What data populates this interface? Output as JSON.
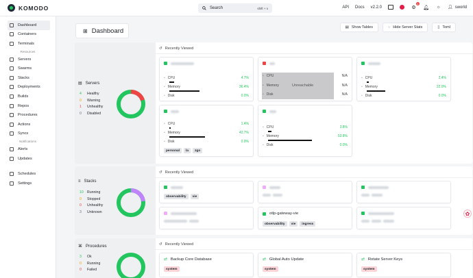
{
  "app": {
    "name": "KOMODO",
    "version": "v2.2.0",
    "user": "sworld",
    "notifications": "1"
  },
  "search": {
    "label": "Search",
    "shortcut": "shift + s"
  },
  "topbar": {
    "api": "API",
    "docs": "Docs"
  },
  "sidebar": {
    "items_top": [
      {
        "label": "Dashboard",
        "icon": "dashboard-icon",
        "active": true
      },
      {
        "label": "Containers",
        "icon": "container-icon"
      },
      {
        "label": "Terminals",
        "icon": "terminal-icon"
      }
    ],
    "resources_label": "Resources",
    "items_resources": [
      {
        "label": "Servers",
        "icon": "server-icon"
      },
      {
        "label": "Swarms",
        "icon": "swarm-icon"
      },
      {
        "label": "Stacks",
        "icon": "stack-icon"
      },
      {
        "label": "Deployments",
        "icon": "deployment-icon"
      },
      {
        "label": "Builds",
        "icon": "build-icon"
      },
      {
        "label": "Repos",
        "icon": "repo-icon"
      },
      {
        "label": "Procedures",
        "icon": "procedure-icon"
      },
      {
        "label": "Actions",
        "icon": "action-icon"
      },
      {
        "label": "Syncs",
        "icon": "sync-icon"
      }
    ],
    "notifications_label": "Notifications",
    "items_notifications": [
      {
        "label": "Alerts",
        "icon": "alert-icon"
      },
      {
        "label": "Updates",
        "icon": "update-icon"
      }
    ],
    "items_bottom": [
      {
        "label": "Schedules",
        "icon": "schedule-icon"
      },
      {
        "label": "Settings",
        "icon": "settings-icon"
      }
    ]
  },
  "page": {
    "title": "Dashboard",
    "buttons": {
      "show_tables": "Show Tables",
      "hide_server_stats": "Hide Server Stats",
      "toml": "Toml"
    },
    "recently_viewed": "Recently Viewed"
  },
  "servers": {
    "title": "Servers",
    "legend": [
      {
        "count": "4",
        "label": "Healthy",
        "color": "#22c55e"
      },
      {
        "count": "0",
        "label": "Warning",
        "color": "#f59e0b"
      },
      {
        "count": "1",
        "label": "Unhealthy",
        "color": "#ef4444"
      },
      {
        "count": "0",
        "label": "Disabled",
        "color": "#6b7280"
      }
    ],
    "cards": {
      "labels": {
        "cpu": "CPU",
        "memory": "Memory",
        "disk": "Disk"
      },
      "s1": {
        "cpu": "4.7%",
        "memory": "36.4%",
        "disk": "0.0%",
        "mem_fill": 0.364
      },
      "s2": {
        "cpu": "N/A",
        "memory": "N/A",
        "disk": "N/A",
        "status": "Unreachable"
      },
      "s3": {
        "cpu": "2.4%",
        "memory": "22.0%",
        "disk": "0.0%",
        "mem_fill": 0.22
      },
      "s4": {
        "cpu": "1.4%",
        "memory": "42.7%",
        "disk": "0.0%",
        "mem_fill": 0.427,
        "tags": [
          "personal",
          "la",
          "zgo"
        ]
      },
      "s5": {
        "cpu": "3.8%",
        "memory": "53.8%",
        "disk": "0.0%",
        "mem_fill": 0.538
      }
    }
  },
  "stacks": {
    "title": "Stacks",
    "legend": [
      {
        "count": "10",
        "label": "Running",
        "color": "#22c55e"
      },
      {
        "count": "0",
        "label": "Stopped",
        "color": "#f59e0b"
      },
      {
        "count": "0",
        "label": "Unhealthy",
        "color": "#ef4444"
      },
      {
        "count": "3",
        "label": "Unknown",
        "color": "#6b7280"
      }
    ],
    "cards": {
      "c1_tags": [
        "observability",
        "vie"
      ],
      "c5_name": "otlp-gateway-vie",
      "c5_tags": [
        "observability",
        "vie",
        "ingress"
      ]
    }
  },
  "procedures": {
    "title": "Procedures",
    "legend": [
      {
        "count": "3",
        "label": "Ok",
        "color": "#22c55e"
      },
      {
        "count": "0",
        "label": "Running",
        "color": "#f59e0b"
      },
      {
        "count": "0",
        "label": "Failed",
        "color": "#ef4444"
      }
    ],
    "cards": [
      {
        "name": "Backup Core Database",
        "tag": "system"
      },
      {
        "name": "Global Auto Update",
        "tag": "system"
      },
      {
        "name": "Rotate Server Keys",
        "tag": "system"
      }
    ]
  },
  "colors": {
    "healthy": "#22c55e",
    "unhealthy": "#ef4444",
    "unknown": "#c084fc",
    "accent": "#1f2328"
  }
}
